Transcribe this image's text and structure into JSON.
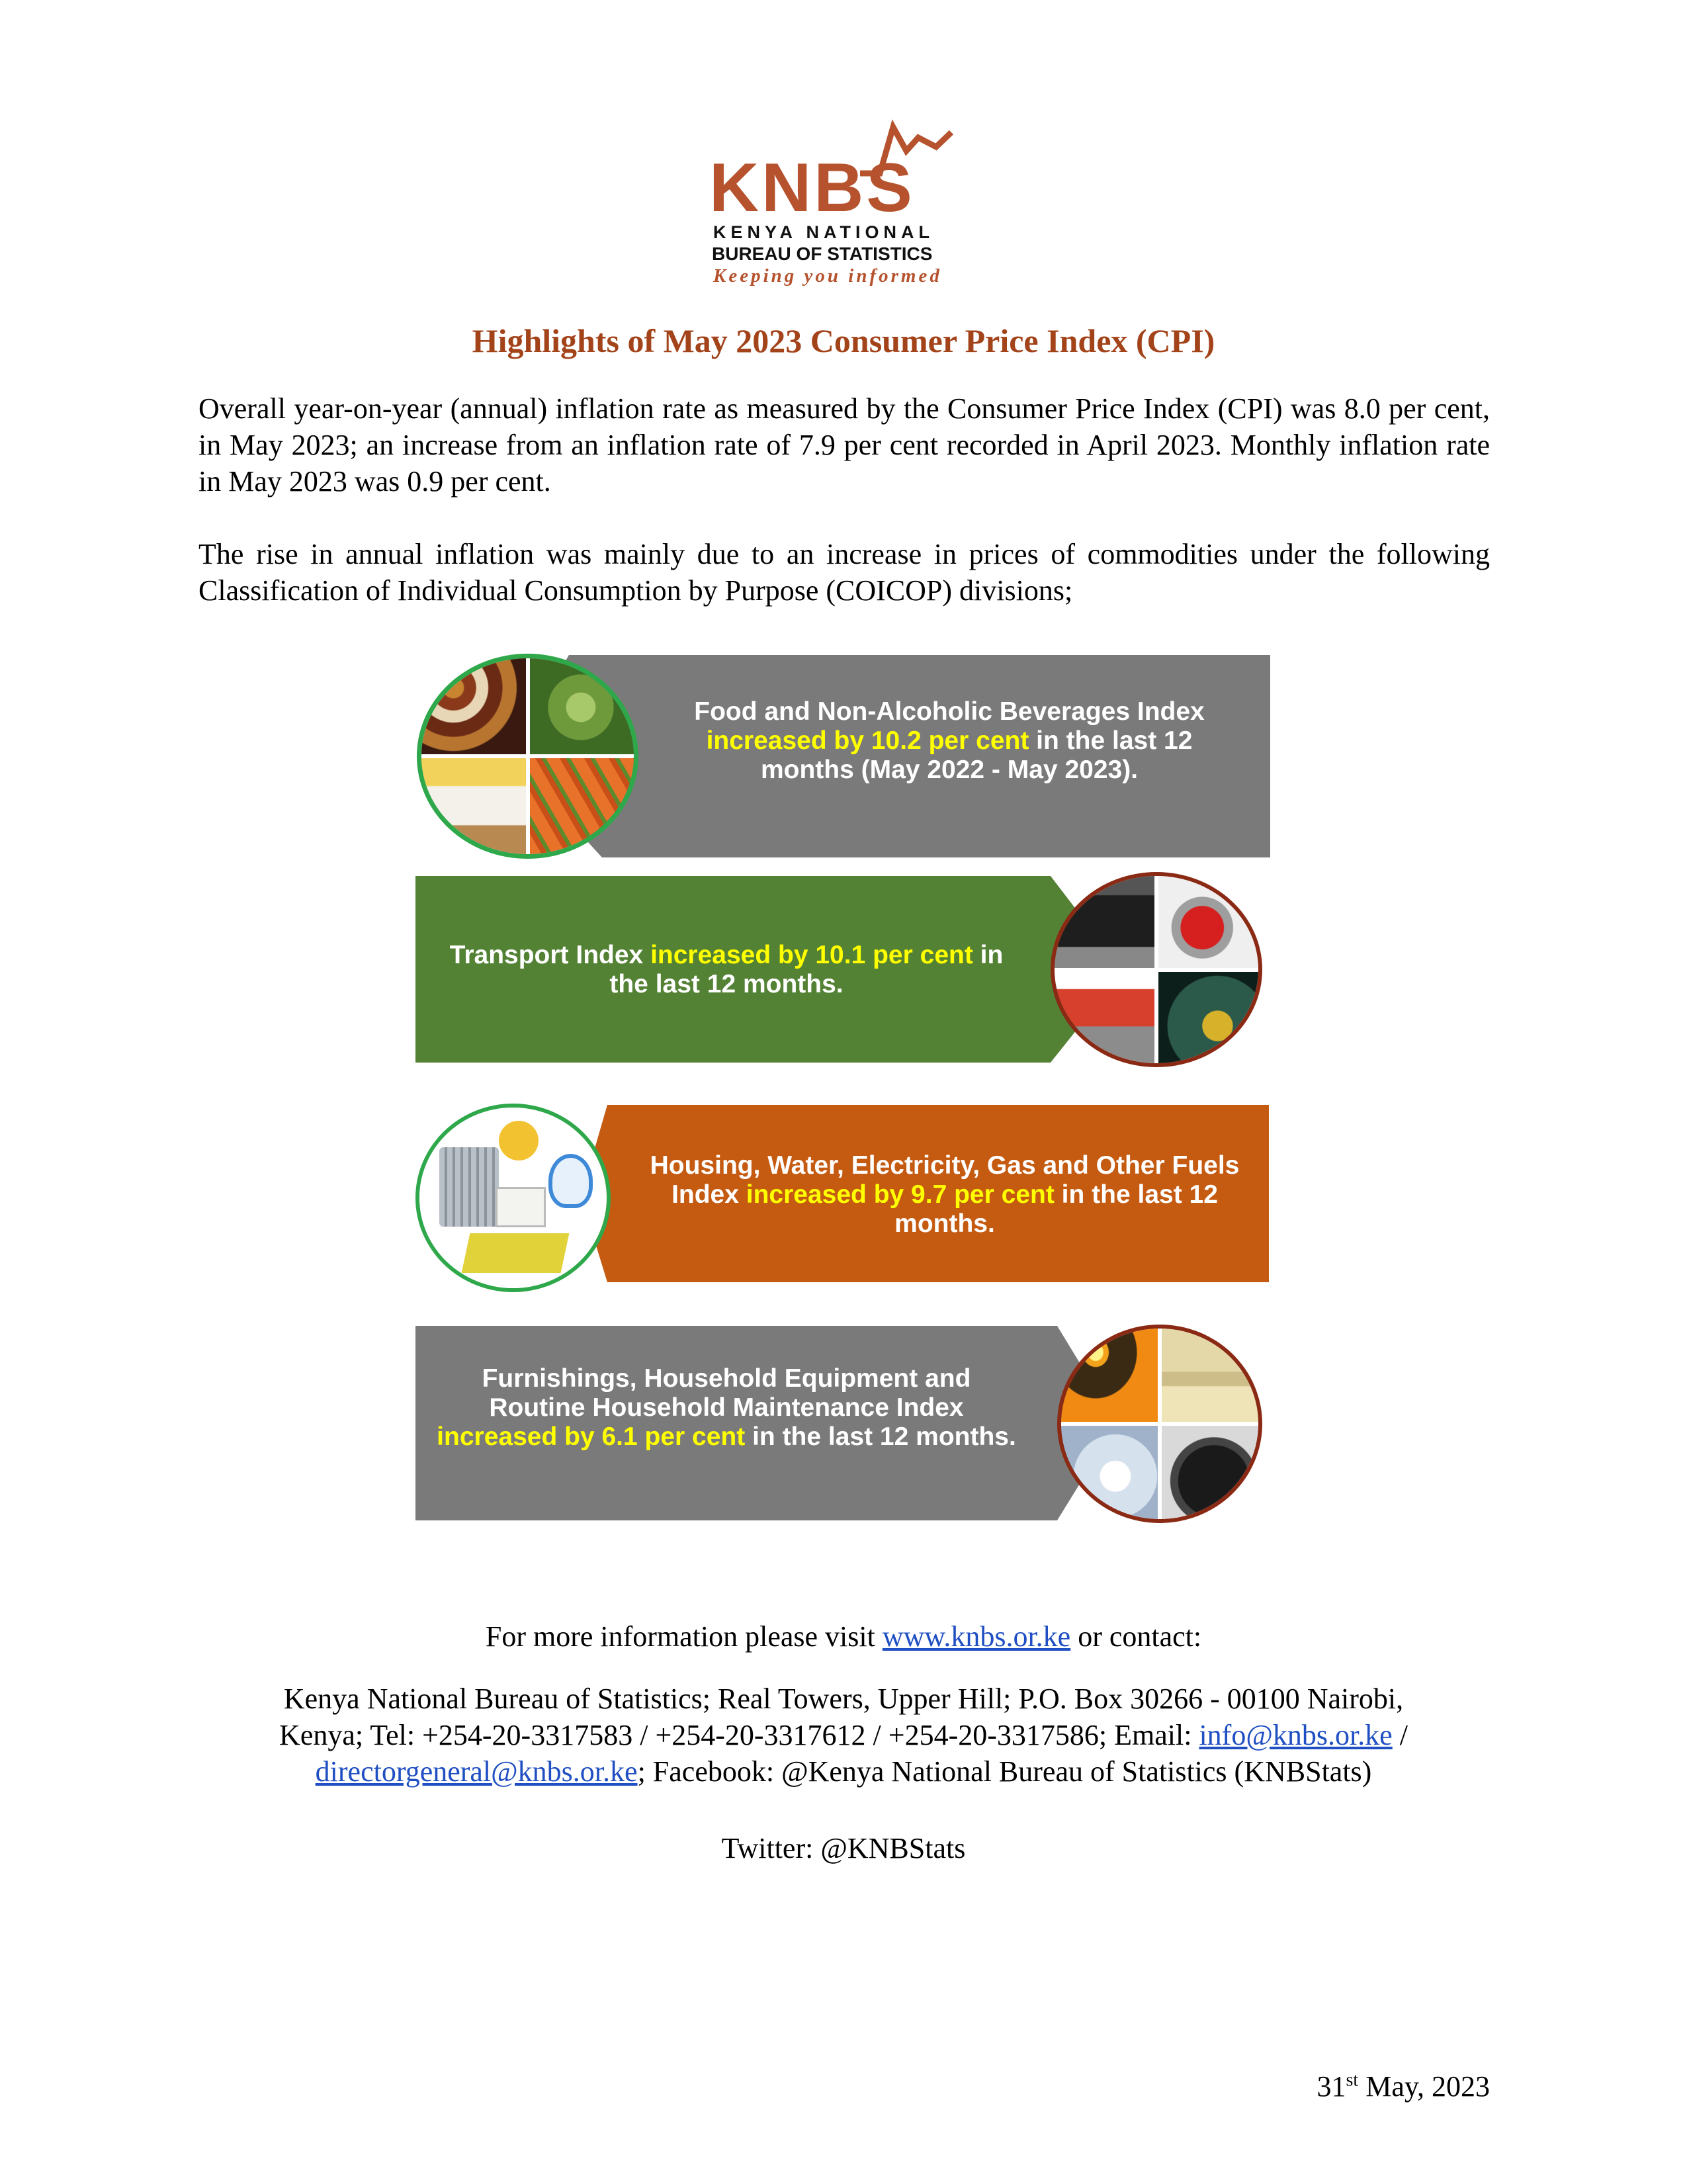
{
  "logo": {
    "name": "KNBS",
    "line1": "KENYA NATIONAL",
    "line2": "BUREAU OF STATISTICS",
    "tagline": "Keeping you informed"
  },
  "title": "Highlights of May 2023 Consumer Price Index (CPI)",
  "paragraphs": [
    "Overall year-on-year (annual) inflation rate as measured by the Consumer Price Index (CPI) was 8.0 per cent, in May 2023; an increase from an inflation rate of 7.9 per cent recorded in April 2023. Monthly inflation rate in May 2023 was 0.9 per cent.",
    "The rise in annual inflation was mainly due to an increase in prices of commodities under the following Classification of Individual Consumption by Purpose (COICOP) divisions;"
  ],
  "banners": [
    {
      "pre": "Food and Non-Alcoholic Beverages Index ",
      "highlight": "increased by 10.2 per cent",
      "post": " in the last 12 months (May 2022 - May 2023).",
      "color": "#7a7a7a",
      "icon": "food-icon"
    },
    {
      "pre": "Transport Index ",
      "highlight": "increased by 10.1 per cent",
      "post": " in the last 12 months.",
      "color": "#5b8a34",
      "icon": "transport-icon"
    },
    {
      "pre": "Housing, Water, Electricity, Gas and Other Fuels Index ",
      "highlight": "increased by 9.7 per cent",
      "post": " in the last 12 months.",
      "color": "#c55a11",
      "icon": "housing-icon"
    },
    {
      "pre": "Furnishings, Household Equipment and Routine Household Maintenance Index ",
      "highlight": "increased by 6.1 per cent",
      "post": " in the last 12 months.",
      "color": "#7a7a7a",
      "icon": "household-icon"
    }
  ],
  "contact": {
    "line1_pre": "For more information please visit ",
    "website": "www.knbs.or.ke",
    "line1_post": " or contact:",
    "address_a": "Kenya National Bureau of Statistics; Real Towers, Upper Hill; P.O. Box 30266 - 00100 Nairobi,",
    "address_b": "Kenya; Tel: +254-20-3317583 / +254-20-3317612 / +254-20-3317586; Email: ",
    "email1": "info@knbs.or.ke",
    "sep": " /",
    "email2": "directorgeneral@knbs.or.ke",
    "facebook": "; Facebook: @Kenya National Bureau of Statistics (KNBStats)",
    "twitter": "Twitter: @KNBStats"
  },
  "date": {
    "day": "31",
    "suffix": "st",
    "rest": " May, 2023"
  }
}
